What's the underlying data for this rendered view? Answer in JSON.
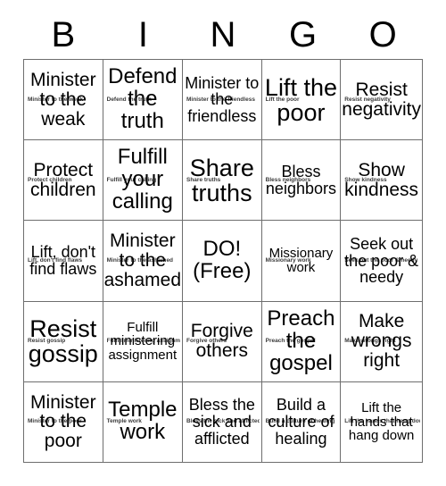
{
  "header": {
    "letters": [
      "B",
      "I",
      "N",
      "G",
      "O"
    ]
  },
  "grid": {
    "columns": 5,
    "rows": 5,
    "cells": [
      {
        "text": "Minister to the weak",
        "caption": "Minister to the weak",
        "size": "fs-md"
      },
      {
        "text": "Defend the truth",
        "caption": "Defend the truth",
        "size": "fs-lg"
      },
      {
        "text": "Minister to the friendless",
        "caption": "Minister to the friendless",
        "size": "fs-sm"
      },
      {
        "text": "Lift the poor",
        "caption": "Lift the poor",
        "size": "fs-xl"
      },
      {
        "text": "Resist negativity",
        "caption": "Resist negativity",
        "size": "fs-md"
      },
      {
        "text": "Protect children",
        "caption": "Protect children",
        "size": "fs-md"
      },
      {
        "text": "Fulfill your calling",
        "caption": "Fulfill your calling",
        "size": "fs-lg"
      },
      {
        "text": "Share truths",
        "caption": "Share truths",
        "size": "fs-xl"
      },
      {
        "text": "Bless neighbors",
        "caption": "Bless neighbors",
        "size": "fs-sm"
      },
      {
        "text": "Show kindness",
        "caption": "Show kindness",
        "size": "fs-md"
      },
      {
        "text": "Lift, don't find flaws",
        "caption": "Lift, don't find flaws",
        "size": "fs-sm"
      },
      {
        "text": "Minister to the ashamed",
        "caption": "Minister to the ashamed",
        "size": "fs-md"
      },
      {
        "text": "DO! (Free)",
        "caption": "",
        "size": "fs-lg"
      },
      {
        "text": "Missionary work",
        "caption": "Missionary work",
        "size": "fs-xs"
      },
      {
        "text": "Seek out the poor & needy",
        "caption": "Seek out the poor & needy",
        "size": "fs-sm"
      },
      {
        "text": "Resist gossip",
        "caption": "Resist gossip",
        "size": "fs-xl"
      },
      {
        "text": "Fulfill ministering assignment",
        "caption": "Fulfill ministering assignment",
        "size": "fs-xs"
      },
      {
        "text": "Forgive others",
        "caption": "Forgive others",
        "size": "fs-md"
      },
      {
        "text": "Preach the gospel",
        "caption": "Preach the gospel",
        "size": "fs-lg"
      },
      {
        "text": "Make wrongs right",
        "caption": "Make wrongs right",
        "size": "fs-md"
      },
      {
        "text": "Minister to the poor",
        "caption": "Minister to the poor",
        "size": "fs-md"
      },
      {
        "text": "Temple work",
        "caption": "Temple work",
        "size": "fs-lg"
      },
      {
        "text": "Bless the sick and afflicted",
        "caption": "Bless the sick and afflicted",
        "size": "fs-sm"
      },
      {
        "text": "Build a culture of healing",
        "caption": "Build a culture of healing",
        "size": "fs-sm"
      },
      {
        "text": "Lift the hands that hang down",
        "caption": "Lift the hands that hang down",
        "size": "fs-xs"
      }
    ]
  },
  "colors": {
    "background": "#ffffff",
    "border": "#6e6e6e",
    "text": "#000000",
    "caption_text": "#3a3a3a"
  }
}
